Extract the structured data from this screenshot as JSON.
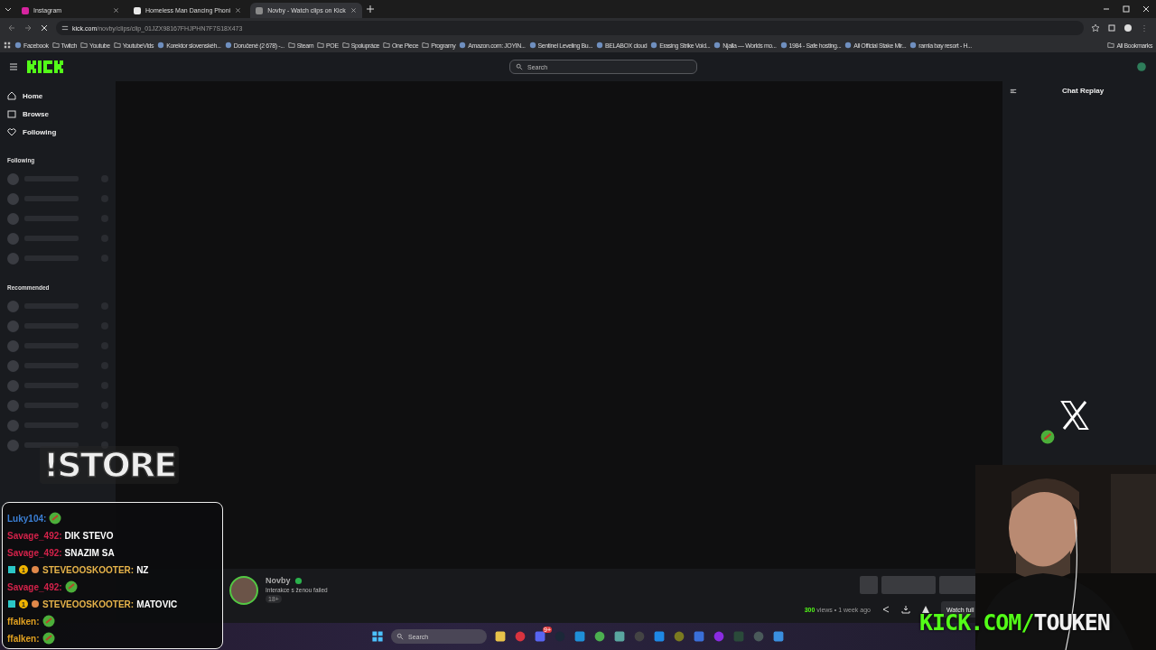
{
  "browser": {
    "tabs": [
      {
        "title": "Instagram",
        "selected": false
      },
      {
        "title": "Homeless Man Dancing Phoni",
        "selected": false
      },
      {
        "title": "Novby - Watch clips on Kick",
        "selected": true
      }
    ],
    "url_host": "kick.com",
    "url_path": "/novby/clips/clip_01JZX98167FHJPHN7F7S18X473",
    "bookmarks": [
      {
        "label": "Facebook",
        "kind": "site"
      },
      {
        "label": "Twitch",
        "kind": "folder"
      },
      {
        "label": "Youtube",
        "kind": "folder"
      },
      {
        "label": "YoutubeVids",
        "kind": "folder"
      },
      {
        "label": "Korektor slovenskéh...",
        "kind": "site"
      },
      {
        "label": "Doručené (2 678) -...",
        "kind": "site"
      },
      {
        "label": "Steam",
        "kind": "folder"
      },
      {
        "label": "POE",
        "kind": "folder"
      },
      {
        "label": "Spolupráce",
        "kind": "folder"
      },
      {
        "label": "One Piece",
        "kind": "folder"
      },
      {
        "label": "Programy",
        "kind": "folder"
      },
      {
        "label": "Amazon.com: JOYIN...",
        "kind": "site"
      },
      {
        "label": "Sentinel Leveling Bu...",
        "kind": "site"
      },
      {
        "label": "BELABOX cloud",
        "kind": "site"
      },
      {
        "label": "Erasing Strike Void...",
        "kind": "site"
      },
      {
        "label": "Njalla — Worlds mo...",
        "kind": "site"
      },
      {
        "label": "1984 - Safe hosting...",
        "kind": "site"
      },
      {
        "label": "All Official Stake Mir...",
        "kind": "site"
      },
      {
        "label": "ramla bay resort - H...",
        "kind": "site"
      }
    ],
    "all_bookmarks": "All Bookmarks"
  },
  "kick": {
    "search": {
      "placeholder": "Search"
    },
    "nav": [
      {
        "label": "Home",
        "kind": "home"
      },
      {
        "label": "Browse",
        "kind": "browse"
      },
      {
        "label": "Following",
        "kind": "heart"
      }
    ],
    "following_title": "Following",
    "recommended_title": "Recommended",
    "chat_title": "Chat Replay",
    "clip": {
      "channel": "Novby",
      "title": "Interakce s ženou failed",
      "badge": "18+",
      "views": "300",
      "meta": "views • 1 week ago",
      "watch_button": "Watch full"
    }
  },
  "overlay": {
    "store": "!STORE",
    "brand_green": "KICK.COM/",
    "brand_white": "TOUKEN",
    "chat": [
      {
        "user": "Luky104:",
        "color": "#3b7fd4"
      },
      {
        "user": "Savage_492:",
        "color": "#d4224a",
        "text": "DIK STEVO"
      },
      {
        "user": "Savage_492:",
        "color": "#d4224a",
        "text": "SNAZIM SA"
      },
      {
        "user": "STEVEOOSKOOTER:",
        "color": "#e6b34a",
        "text": "NZ",
        "badges": "1"
      },
      {
        "user": "Savage_492:",
        "color": "#d4224a"
      },
      {
        "user": "STEVEOOSKOOTER:",
        "color": "#e6b34a",
        "text": "MATOVIC",
        "badges": "1"
      },
      {
        "user": "ffalken:",
        "color": "#e0a020"
      },
      {
        "user": "ffalken:",
        "color": "#e0a020"
      }
    ]
  },
  "taskbar": {
    "search_placeholder": "Search",
    "chat_badge": "9+"
  }
}
